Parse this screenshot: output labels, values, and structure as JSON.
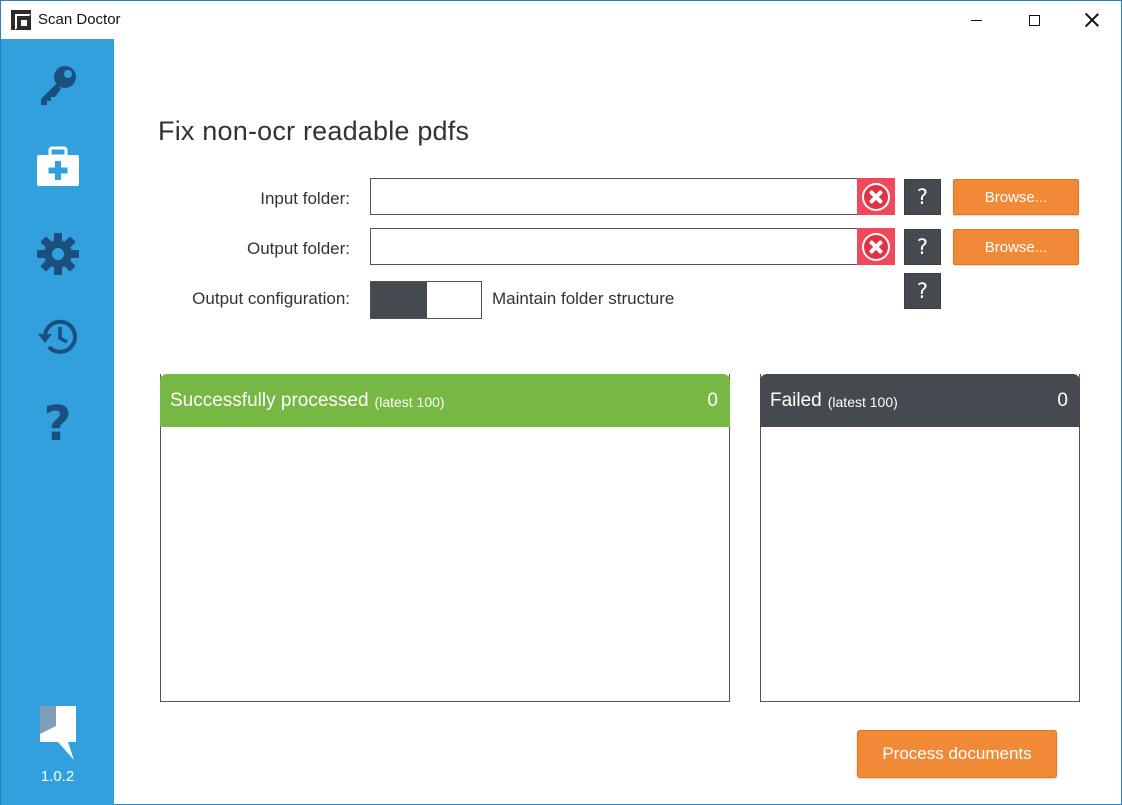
{
  "window": {
    "title": "Scan Doctor"
  },
  "sidebar": {
    "items": [
      {
        "icon": "key-icon"
      },
      {
        "icon": "medical-kit-icon"
      },
      {
        "icon": "gear-icon"
      },
      {
        "icon": "history-icon"
      },
      {
        "icon": "help-icon",
        "glyph": "?"
      }
    ],
    "version": "1.0.2"
  },
  "main": {
    "title": "Fix non-ocr readable pdfs",
    "input_folder": {
      "label": "Input folder:",
      "value": "",
      "browse_label": "Browse...",
      "help": "?"
    },
    "output_folder": {
      "label": "Output folder:",
      "value": "",
      "browse_label": "Browse...",
      "help": "?"
    },
    "output_configuration": {
      "label": "Output configuration:",
      "toggle_on": true,
      "toggle_label": "Maintain folder structure",
      "help": "?"
    }
  },
  "panels": {
    "success": {
      "title": "Successfully processed",
      "subtitle": "(latest 100)",
      "count": "0",
      "color": "#76b843"
    },
    "failed": {
      "title": "Failed",
      "subtitle": "(latest 100)",
      "count": "0",
      "color": "#454a51"
    }
  },
  "actions": {
    "process_label": "Process documents"
  },
  "colors": {
    "sidebar": "#31a0dc",
    "sidebar_icon": "#1a4f80",
    "accent_orange": "#f08a36",
    "dark": "#454a51",
    "clear_red": "#f0495a"
  }
}
